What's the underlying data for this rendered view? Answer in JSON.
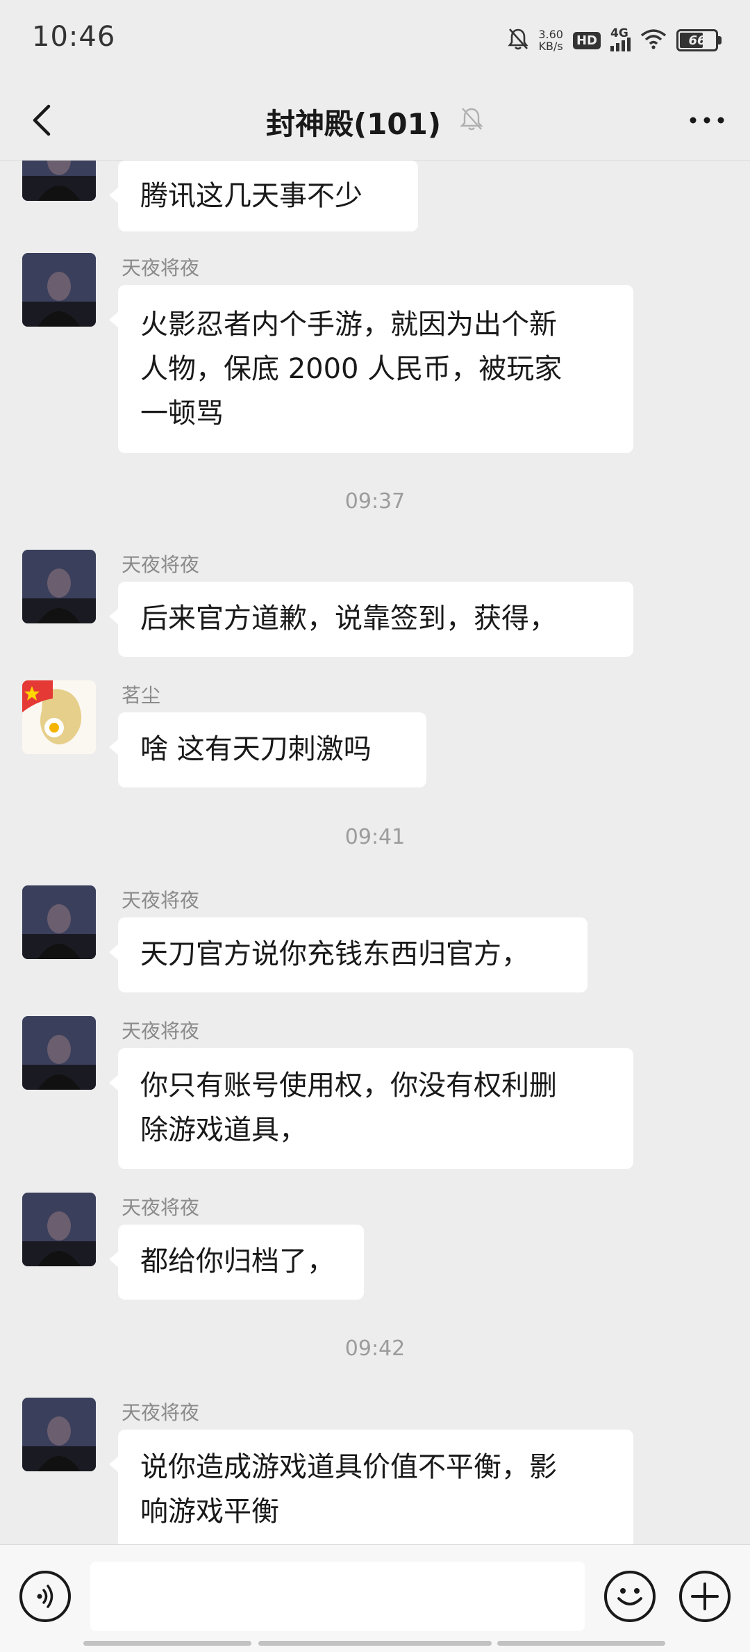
{
  "status_bar": {
    "time": "10:46",
    "net_speed_value": "3.60",
    "net_speed_unit": "KB/s",
    "hd_label": "HD",
    "network_label": "4G",
    "battery_level": "66",
    "icons": [
      "mute-icon",
      "hd-icon",
      "signal-icon",
      "wifi-icon",
      "battery-icon"
    ]
  },
  "header": {
    "title": "封神殿(101)",
    "icons": [
      "back-arrow-icon",
      "muted-bell-icon",
      "more-dots-icon"
    ]
  },
  "messages": [
    {
      "sender": "",
      "avatar": "avatar-tianye",
      "lines": [
        "腾讯这几天事不少"
      ]
    },
    {
      "sender": "天夜将夜",
      "avatar": "avatar-tianye",
      "lines": [
        "火影忍者内个手游，就因为出个新",
        "人物，保底 2000 人民币，被玩家",
        "一顿骂"
      ]
    },
    {
      "timestamp": "09:37"
    },
    {
      "sender": "天夜将夜",
      "avatar": "avatar-tianye",
      "lines": [
        "后来官方道歉，说靠签到，获得，"
      ]
    },
    {
      "sender": "茗尘",
      "avatar": "avatar-mingchen",
      "lines": [
        "啥 这有天刀刺激吗"
      ]
    },
    {
      "timestamp": "09:41"
    },
    {
      "sender": "天夜将夜",
      "avatar": "avatar-tianye",
      "lines": [
        "天刀官方说你充钱东西归官方，"
      ]
    },
    {
      "sender": "天夜将夜",
      "avatar": "avatar-tianye",
      "lines": [
        "你只有账号使用权，你没有权利删",
        "除游戏道具，"
      ]
    },
    {
      "sender": "天夜将夜",
      "avatar": "avatar-tianye",
      "lines": [
        "都给你归档了，"
      ]
    },
    {
      "timestamp": "09:42"
    },
    {
      "sender": "天夜将夜",
      "avatar": "avatar-tianye",
      "lines": [
        "说你造成游戏道具价值不平衡，影",
        "响游戏平衡"
      ]
    }
  ],
  "input_bar": {
    "placeholder": "",
    "icons": [
      "voice-icon",
      "emoji-icon",
      "plus-icon"
    ]
  },
  "colors": {
    "background": "#ededed",
    "bubble": "#ffffff",
    "sender_text": "#8a8a8a",
    "timestamp_text": "#9c9c9c"
  }
}
